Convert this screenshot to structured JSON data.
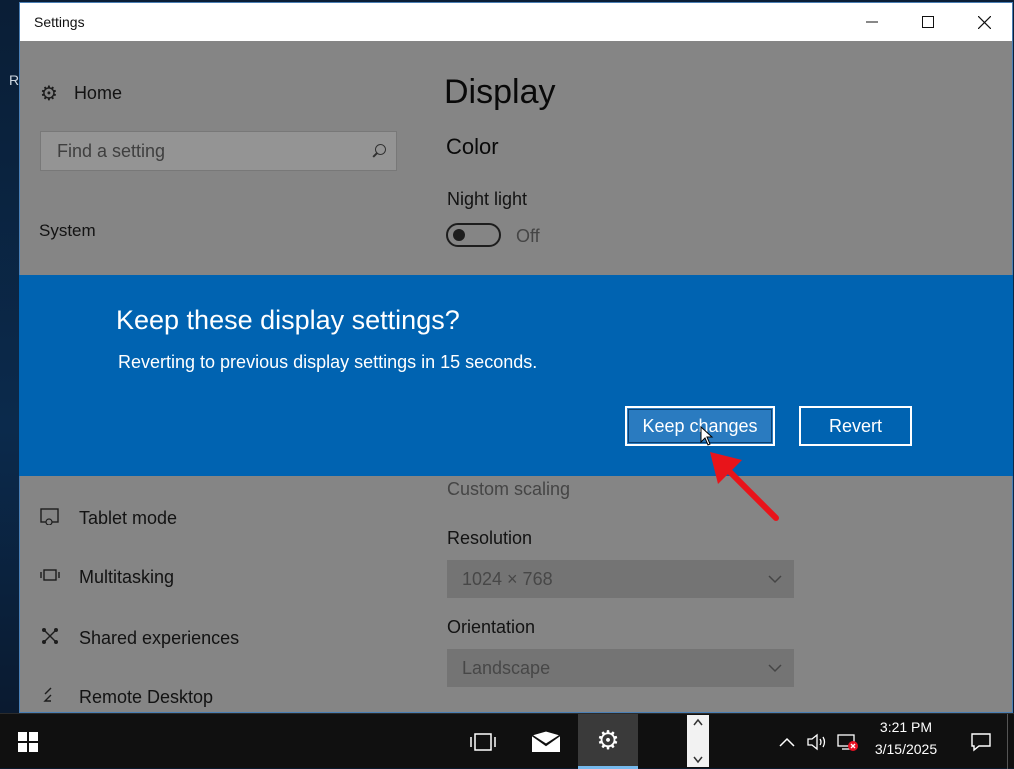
{
  "window": {
    "title": "Settings"
  },
  "desktop": {
    "edge_glyph": "R"
  },
  "nav": {
    "home_label": "Home",
    "search_placeholder": "Find a setting",
    "section": "System",
    "items": [
      {
        "label": "Tablet mode",
        "icon": "tablet-icon"
      },
      {
        "label": "Multitasking",
        "icon": "multitasking-icon"
      },
      {
        "label": "Shared experiences",
        "icon": "shared-experiences-icon"
      },
      {
        "label": "Remote Desktop",
        "icon": "remote-desktop-icon"
      }
    ]
  },
  "main": {
    "page_title": "Display",
    "color_heading": "Color",
    "night_light_label": "Night light",
    "night_light_state": "Off",
    "custom_scaling_link": "Custom scaling",
    "resolution_label": "Resolution",
    "resolution_value": "1024 × 768",
    "orientation_label": "Orientation",
    "orientation_value": "Landscape"
  },
  "dialog": {
    "title": "Keep these display settings?",
    "message": "Reverting to previous display settings in 15 seconds.",
    "keep_label": "Keep changes",
    "revert_label": "Revert",
    "background": "#0063b1"
  },
  "annotation": {
    "arrow_color": "#e8141a"
  },
  "taskbar": {
    "time": "3:21 PM",
    "date": "3/15/2025"
  },
  "colors": {
    "accent": "#0063b1",
    "taskbar_active_underline": "#76b9ed"
  }
}
